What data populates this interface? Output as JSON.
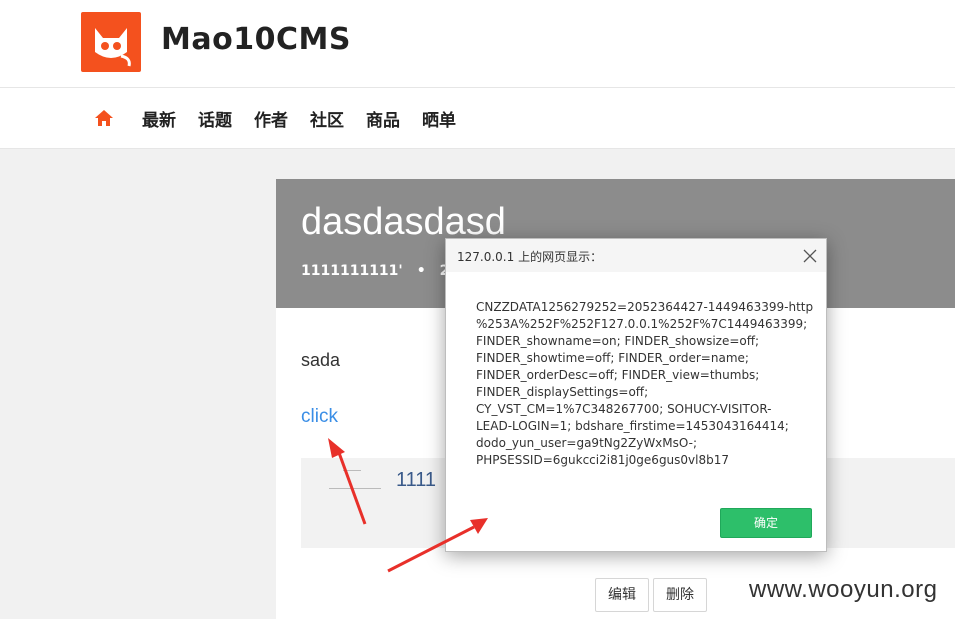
{
  "header": {
    "logo_icon": "cat-logo-icon",
    "site_name": "Mao10CMS"
  },
  "nav": {
    "home_icon": "home-icon",
    "items": [
      "最新",
      "话题",
      "作者",
      "社区",
      "商品",
      "晒单"
    ]
  },
  "article": {
    "title": "dasdasdasd",
    "meta_author": "1111111111'",
    "meta_date_partial": "20",
    "body_text": "sada",
    "link_text": "click",
    "embed_text": "1111",
    "edit_label": "编辑",
    "delete_label": "删除"
  },
  "dialog": {
    "title": "127.0.0.1 上的网页显示：",
    "message_lines": [
      "CNZZDATA1256279252=2052364427-1449463399-http",
      "%253A%252F%252F127.0.0.1%252F%7C1449463399;",
      "FINDER_showname=on; FINDER_showsize=off;",
      "FINDER_showtime=off; FINDER_order=name;",
      "FINDER_orderDesc=off; FINDER_view=thumbs;",
      "FINDER_displaySettings=off;",
      "CY_VST_CM=1%7C348267700; SOHUCY-VISITOR-",
      "LEAD-LOGIN=1; bdshare_firstime=1453043164414;",
      "dodo_yun_user=ga9tNg2ZyWxMsO-;",
      "PHPSESSID=6gukcci2i81j0ge6gus0vl8b17"
    ],
    "ok_label": "确定"
  },
  "watermark": "www.wooyun.org",
  "colors": {
    "accent": "#f4511e",
    "link": "#3a8ee6",
    "ok_button": "#2dbf6a",
    "arrow": "#e8302a"
  }
}
